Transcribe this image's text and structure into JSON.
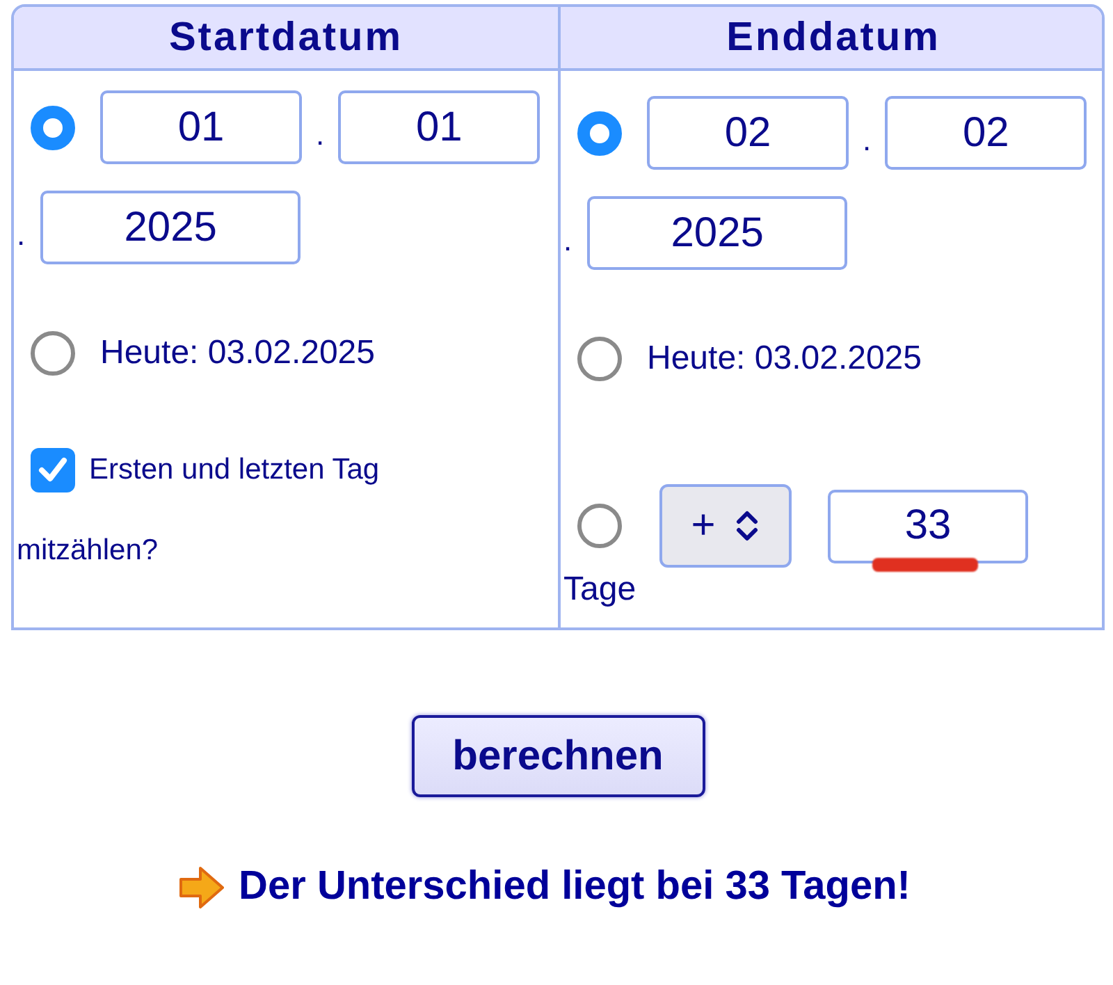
{
  "columns": [
    {
      "heading": "Startdatum",
      "date_option": {
        "selected": true,
        "day": "01",
        "month": "01",
        "year": "2025",
        "separators": [
          ".",
          "."
        ]
      },
      "today_option": {
        "selected": false,
        "label": "Heute: 03.02.2025"
      },
      "extra": {
        "kind": "checkbox",
        "checked": true,
        "label_lines": [
          "Ersten und letzten Tag",
          "mitzählen?"
        ]
      }
    },
    {
      "heading": "Enddatum",
      "date_option": {
        "selected": true,
        "day": "02",
        "month": "02",
        "year": "2025",
        "separators": [
          ".",
          "."
        ]
      },
      "today_option": {
        "selected": false,
        "label": "Heute: 03.02.2025"
      },
      "extra": {
        "kind": "offset",
        "selected": false,
        "sign": "+",
        "days": "33",
        "unit": "Tage"
      }
    }
  ],
  "button": "berechnen",
  "result": "Der Unterschied liegt bei 33 Tagen!"
}
